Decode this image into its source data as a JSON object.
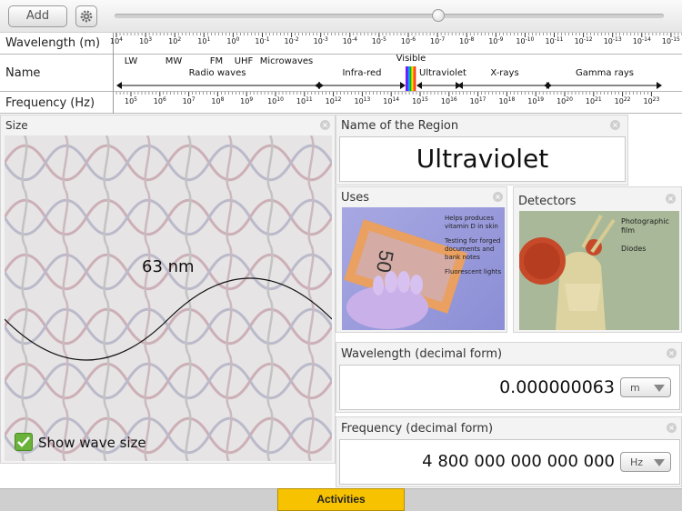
{
  "toolbar": {
    "add_label": "Add",
    "settings_icon": "gear-icon",
    "slider_value": 0.59
  },
  "spectrum": {
    "wavelength_label": "Wavelength (m)",
    "name_label": "Name",
    "frequency_label": "Frequency (Hz)",
    "wavelength_exponents": [
      "4",
      "3",
      "2",
      "1",
      "0",
      "-1",
      "-2",
      "-3",
      "-4",
      "-5",
      "-6",
      "-7",
      "-8",
      "-9",
      "-10",
      "-11",
      "-12",
      "-13",
      "-14",
      "-15"
    ],
    "frequency_exponents": [
      "5",
      "6",
      "7",
      "8",
      "9",
      "10",
      "11",
      "12",
      "13",
      "14",
      "15",
      "16",
      "17",
      "18",
      "19",
      "20",
      "21",
      "22",
      "23"
    ],
    "tick_base": "10",
    "top_names": [
      "LW",
      "MW",
      "FM",
      "UHF",
      "Microwaves"
    ],
    "visible_label": "Visible",
    "region_names": [
      "Radio waves",
      "Infra-red",
      "Ultraviolet",
      "X-rays",
      "Gamma rays"
    ],
    "visible_colors": [
      "#8b00ff",
      "#3b3bff",
      "#00a0ff",
      "#00c000",
      "#ffe000",
      "#ff8c00",
      "#ff2020"
    ]
  },
  "size_panel": {
    "title": "Size",
    "wave_size_label": "63 nm",
    "show_wave_label": "Show wave size",
    "show_wave_checked": true
  },
  "name_panel": {
    "title": "Name of the Region",
    "value": "Ultraviolet"
  },
  "uses_panel": {
    "title": "Uses",
    "notes": [
      "Helps produces vitamin D in skin",
      "Testing for forged documents and bank notes",
      "Fluorescent lights"
    ]
  },
  "detectors_panel": {
    "title": "Detectors",
    "notes": [
      "Photographic film",
      "Diodes"
    ]
  },
  "wavelength_panel": {
    "title": "Wavelength (decimal form)",
    "value": "0.000000063",
    "unit": "m"
  },
  "frequency_panel": {
    "title": "Frequency (decimal form)",
    "value": "4 800 000 000 000 000",
    "unit": "Hz"
  },
  "bottom": {
    "activities_label": "Activities"
  }
}
